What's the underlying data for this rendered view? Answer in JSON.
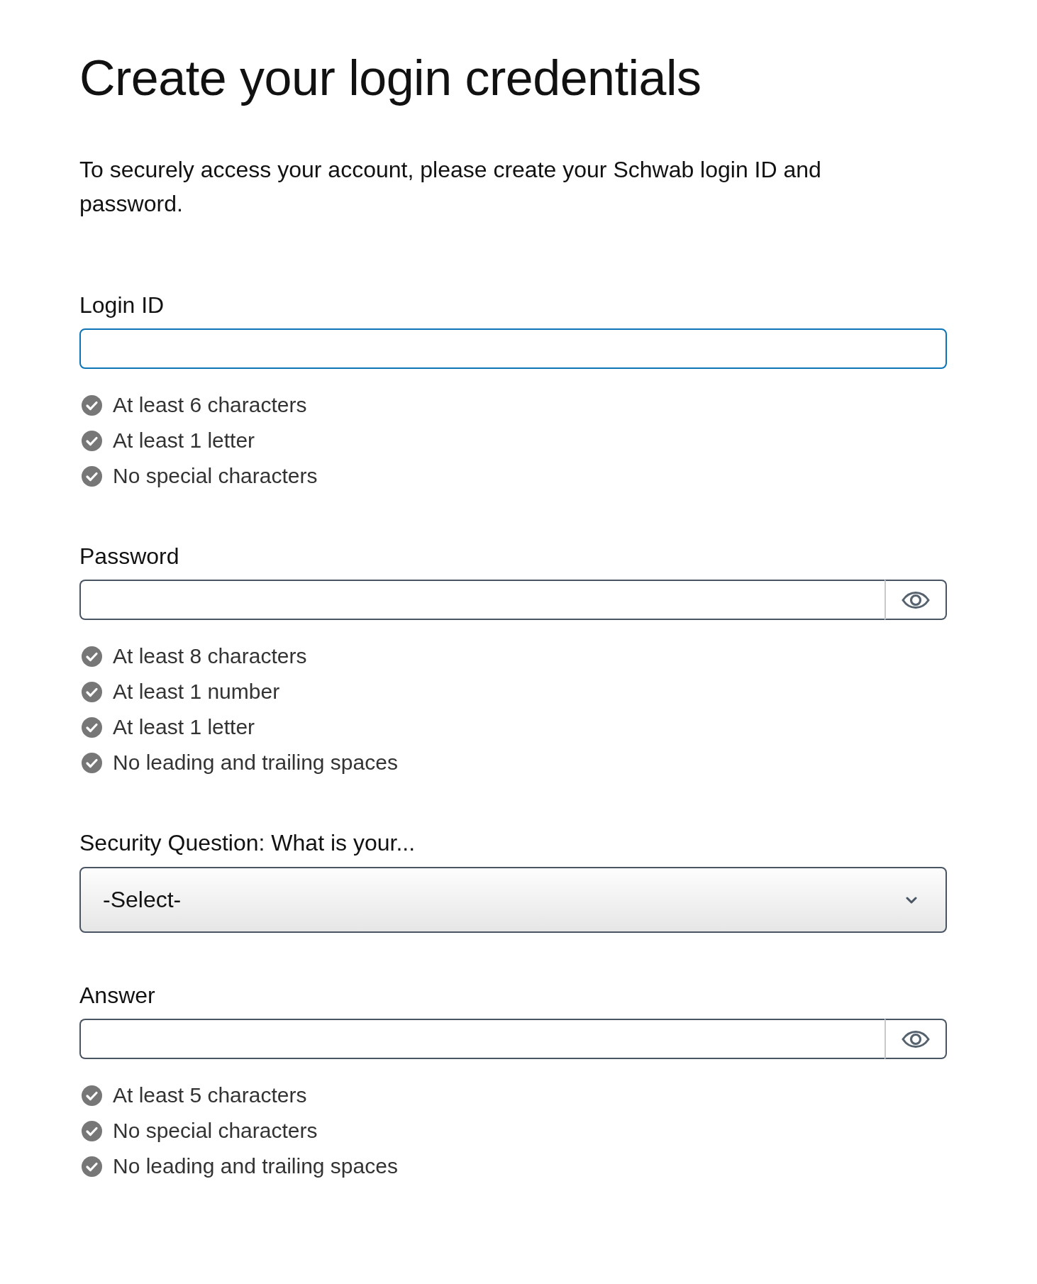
{
  "page": {
    "title": "Create your login credentials",
    "intro": "To securely access your account, please create your Schwab login ID and password."
  },
  "fields": [
    {
      "kind": "text",
      "label": "Login ID",
      "focused": true,
      "rules": [
        {
          "text": "At least 6 characters",
          "met": false
        },
        {
          "text": "At least 1 letter",
          "met": false
        },
        {
          "text": "No special characters",
          "met": false
        }
      ]
    },
    {
      "kind": "secret",
      "label": "Password",
      "focused": false,
      "rules": [
        {
          "text": "At least 8 characters",
          "met": false
        },
        {
          "text": "At least 1 number",
          "met": false
        },
        {
          "text": "At least 1 letter",
          "met": false
        },
        {
          "text": "No leading and trailing spaces",
          "met": false
        }
      ]
    },
    {
      "kind": "select",
      "label": "Security Question: What is your...",
      "value": "-Select-"
    },
    {
      "kind": "secret",
      "label": "Answer",
      "focused": false,
      "rules": [
        {
          "text": "At least 5 characters",
          "met": false
        },
        {
          "text": "No special characters",
          "met": false
        },
        {
          "text": "No leading and trailing spaces",
          "met": false
        }
      ]
    }
  ]
}
